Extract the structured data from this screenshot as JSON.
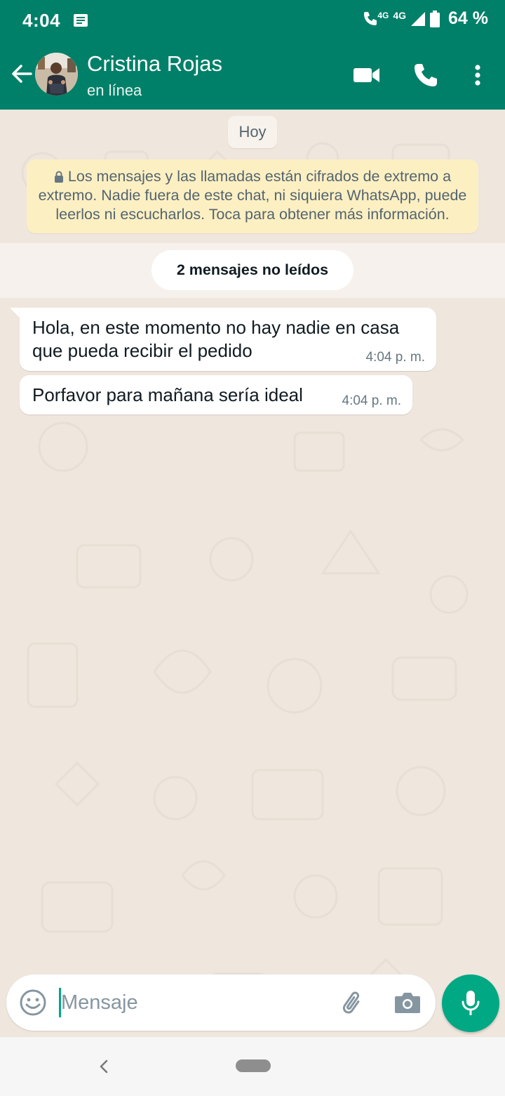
{
  "status_bar": {
    "time": "4:04",
    "network_1": "4G",
    "network_2": "4G",
    "battery": "64 %"
  },
  "header": {
    "contact_name": "Cristina Rojas",
    "contact_status": "en línea",
    "icons": [
      "back-arrow",
      "video-camera",
      "phone",
      "more-vertical"
    ]
  },
  "chat": {
    "date_chip": "Hoy",
    "encryption_notice": "Los mensajes y las llamadas están cifrados de extremo a extremo. Nadie fuera de este chat, ni siquiera WhatsApp, puede leerlos ni escucharlos. Toca para obtener más información.",
    "unread_label": "2 mensajes no leídos",
    "messages": [
      {
        "text_line1": "Hola, en este momento no hay nadie en casa",
        "text_line2": "que pueda recibir el pedido",
        "time": "4:04 p. m."
      },
      {
        "text": "Porfavor para mañana sería ideal",
        "time": "4:04 p. m."
      }
    ]
  },
  "composer": {
    "placeholder": "Mensaje",
    "icons": [
      "emoji",
      "attach",
      "camera",
      "microphone"
    ]
  },
  "colors": {
    "primary": "#008069",
    "accent": "#00a884",
    "chat_background": "#efe6dd",
    "notice_background": "#fcefc2"
  }
}
